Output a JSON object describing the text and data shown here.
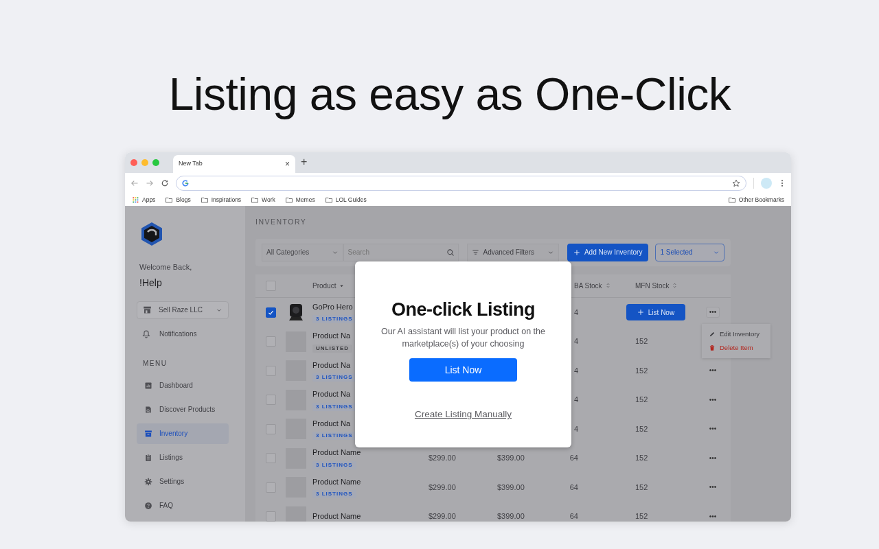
{
  "headline": "Listing as easy as One-Click",
  "browser": {
    "tab_title": "New Tab",
    "tab_close": "×",
    "new_tab": "+",
    "bookmarks": [
      {
        "label": "Apps",
        "kind": "apps"
      },
      {
        "label": "Blogs",
        "kind": "folder"
      },
      {
        "label": "Inspirations",
        "kind": "folder"
      },
      {
        "label": "Work",
        "kind": "folder"
      },
      {
        "label": "Memes",
        "kind": "folder"
      },
      {
        "label": "LOL Guides",
        "kind": "folder"
      }
    ],
    "other_bookmarks": "Other Bookmarks"
  },
  "sidebar": {
    "welcome": "Welcome Back,",
    "user": "!Help",
    "store": "Sell Raze LLC",
    "notifications": "Notifications",
    "menu_heading": "MENU",
    "items": [
      {
        "label": "Dashboard",
        "selected": false
      },
      {
        "label": "Discover Products",
        "selected": false
      },
      {
        "label": "Inventory",
        "selected": true
      },
      {
        "label": "Listings",
        "selected": false
      },
      {
        "label": "Settings",
        "selected": false
      },
      {
        "label": "FAQ",
        "selected": false
      }
    ]
  },
  "page_title": "INVENTORY",
  "toolbar": {
    "category": "All Categories",
    "search_placeholder": "Search",
    "filters": "Advanced Filters",
    "add_button": "Add New Inventory",
    "selection": "1 Selected"
  },
  "table": {
    "all_selected": false,
    "header": {
      "product": "Product",
      "column_6": "BA Stock",
      "mfn_stock": "MFN Stock"
    },
    "rows": [
      {
        "selected": true,
        "kind": "photo",
        "name": "GoPro Hero",
        "badge": {
          "text": "3 LISTINGS",
          "kind": "listed"
        },
        "column_6": "4",
        "action": "List Now",
        "more": "•••"
      },
      {
        "selected": false,
        "kind": "placeholder",
        "name": "Product Na",
        "badge": {
          "text": "UNLISTED",
          "kind": "unlisted"
        },
        "column_6": "4",
        "mfn_stock": "152"
      },
      {
        "selected": false,
        "kind": "placeholder",
        "name": "Product Na",
        "badge": {
          "text": "3 LISTINGS",
          "kind": "listed"
        },
        "column_6": "4",
        "mfn_stock": "152",
        "more": "•••"
      },
      {
        "selected": false,
        "kind": "placeholder",
        "name": "Product Na",
        "badge": {
          "text": "3 LISTINGS",
          "kind": "listed"
        },
        "column_6": "4",
        "mfn_stock": "152",
        "more": "•••"
      },
      {
        "selected": false,
        "kind": "placeholder",
        "name": "Product Na",
        "badge": {
          "text": "3 LISTINGS",
          "kind": "listed"
        },
        "column_6": "4",
        "mfn_stock": "152",
        "more": "•••"
      },
      {
        "selected": false,
        "kind": "placeholder",
        "name": "Product Name",
        "badge": {
          "text": "3 LISTINGS",
          "kind": "listed"
        },
        "price": "$299.00",
        "price_2": "$399.00",
        "column_6": "64",
        "mfn_stock": "152",
        "more": "•••"
      },
      {
        "selected": false,
        "kind": "placeholder",
        "name": "Product Name",
        "badge": {
          "text": "3 LISTINGS",
          "kind": "listed"
        },
        "price": "$299.00",
        "price_2": "$399.00",
        "column_6": "64",
        "mfn_stock": "152",
        "more": "•••"
      },
      {
        "selected": false,
        "kind": "placeholder",
        "name": "Product Name",
        "price": "$299.00",
        "price_2": "$399.00",
        "column_6": "64",
        "mfn_stock": "152",
        "more": "•••"
      }
    ]
  },
  "row_menu": {
    "items": [
      {
        "label": "Edit Inventory",
        "kind": "edit"
      },
      {
        "label": "Delete Item",
        "kind": "delete"
      }
    ]
  },
  "modal": {
    "title": "One-click Listing",
    "text": "Our AI assistant will list your product on the marketplace(s) of your choosing",
    "button": "List Now",
    "link": "Create Listing Manually"
  }
}
